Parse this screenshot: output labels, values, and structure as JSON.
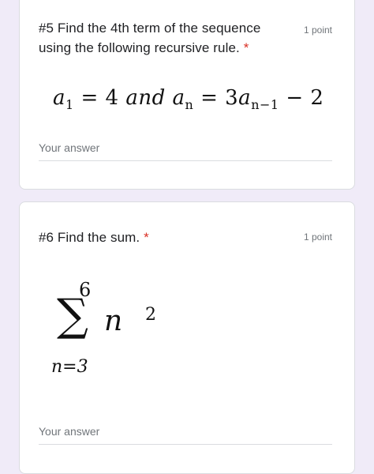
{
  "questions": [
    {
      "title": "#5 Find the 4th term of the sequence using the following recursive rule.",
      "required_marker": "*",
      "points": "1 point",
      "answer_placeholder": "Your answer",
      "equation": {
        "a1_var": "a",
        "a1_sub": "1",
        "eq1": " = 4 ",
        "and": "and",
        "an_var": "a",
        "an_sub": "n",
        "eq2": " = 3",
        "an1_var": "a",
        "an1_sub": "n−1",
        "tail": " − 2"
      }
    },
    {
      "title": "#6 Find the sum.",
      "required_marker": "*",
      "points": "1 point",
      "answer_placeholder": "Your answer",
      "sum": {
        "upper": "6",
        "sigma": "∑",
        "term": "n",
        "exponent": "2",
        "lower": "n=3"
      }
    }
  ],
  "colors": {
    "background": "#f0ebf8",
    "card": "#ffffff",
    "required": "#d93025",
    "muted_text": "#70757a"
  }
}
